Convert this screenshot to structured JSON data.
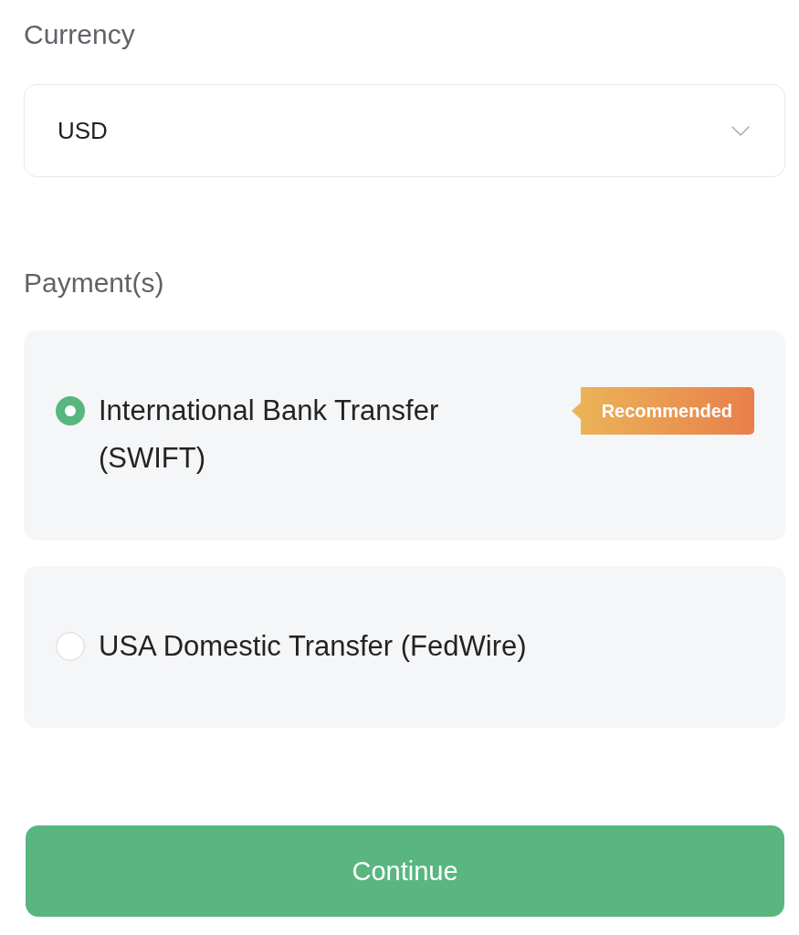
{
  "currency": {
    "label": "Currency",
    "value": "USD"
  },
  "payments": {
    "label": "Payment(s)",
    "options": [
      {
        "label": "International Bank Transfer (SWIFT)",
        "selected": true,
        "badge": "Recommended"
      },
      {
        "label": "USA Domestic Transfer (FedWire)",
        "selected": false
      }
    ]
  },
  "continue_button": {
    "label": "Continue"
  }
}
